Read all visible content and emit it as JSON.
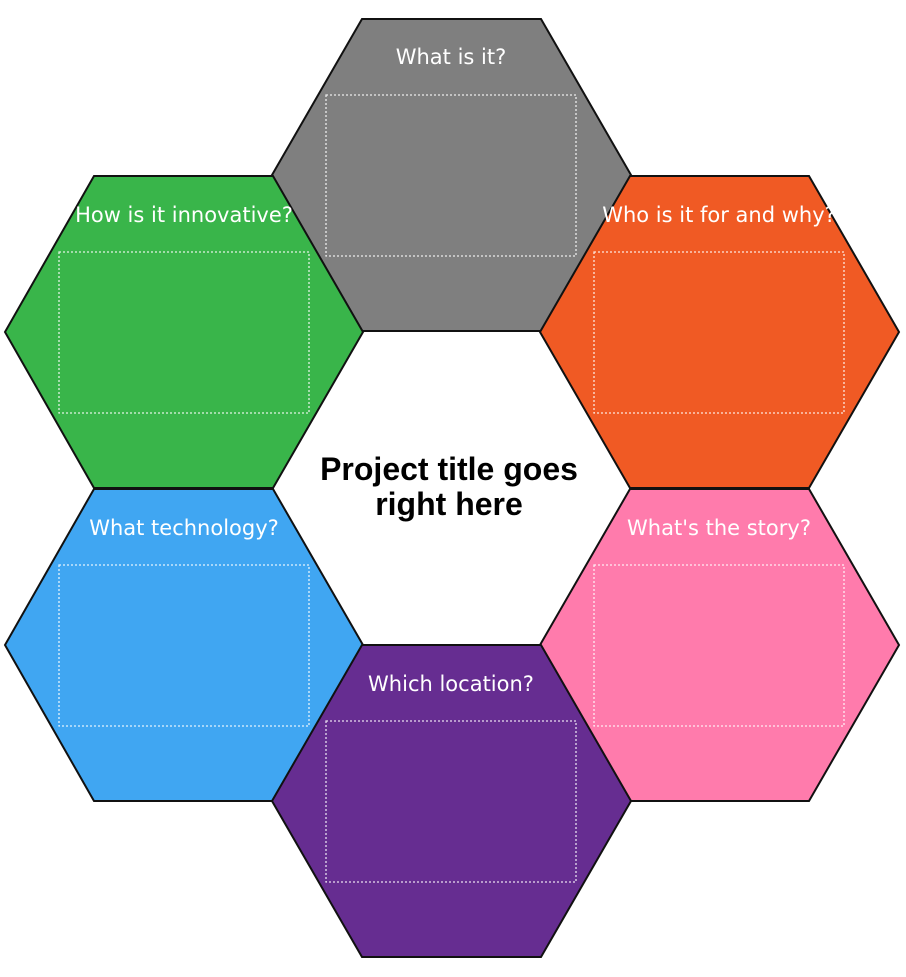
{
  "diagram": {
    "center": {
      "title_line1": "Project title goes",
      "title_line2": "right here"
    },
    "hexagons": [
      {
        "id": "what-is-it",
        "label": "What is it?",
        "color": "#7f7f7f"
      },
      {
        "id": "who-is-it-for",
        "label": "Who is it for and why?",
        "color": "#f05a24"
      },
      {
        "id": "whats-the-story",
        "label": "What's the story?",
        "color": "#ff7bac"
      },
      {
        "id": "which-location",
        "label": "Which location?",
        "color": "#662d91"
      },
      {
        "id": "what-technology",
        "label": "What technology?",
        "color": "#40a6f2"
      },
      {
        "id": "how-innovative",
        "label": "How is it innovative?",
        "color": "#39b54a"
      }
    ]
  }
}
